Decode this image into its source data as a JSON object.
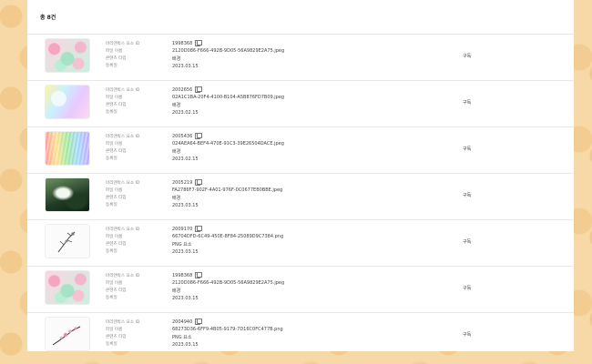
{
  "header": {
    "total": "총 8건"
  },
  "field_labels": {
    "id": "마리엔박스 요소 ID",
    "file": "파일 이름",
    "type": "콘텐츠 타입",
    "date": "등록일"
  },
  "rows": [
    {
      "id": "1998368",
      "file": "2120D086-F666-492B-9D05-56A9829E2A75.jpeg",
      "type": "배경",
      "date": "2023.03.15",
      "action": "구독",
      "thumb": "pastel-pattern"
    },
    {
      "id": "2002656",
      "file": "02A1C1BA-20F4-4100-B104-A5B876FD7B09.jpeg",
      "type": "배경",
      "date": "2023.02.15",
      "action": "구독",
      "thumb": "rainbow-texture"
    },
    {
      "id": "2005436",
      "file": "024AEA64-BEF4-470E-91C3-39E26504DACE.jpeg",
      "type": "배경",
      "date": "2023.02.15",
      "action": "구독",
      "thumb": "crayon-texture"
    },
    {
      "id": "2005219",
      "file": "FA2786F7-902F-4A01-976F-0C0677EB0BBE.jpeg",
      "type": "배경",
      "date": "2023.03.15",
      "action": "구독",
      "thumb": "green-paint"
    },
    {
      "id": "2009170",
      "file": "66704DFD-6C49-450E-8F84-25089D9C7384.png",
      "type": "PNG 요소",
      "date": "2023.03.15",
      "action": "구독",
      "thumb": "sketch-branch"
    },
    {
      "id": "1998368",
      "file": "2120D086-F666-492B-9D05-56A9829E2A75.jpeg",
      "type": "배경",
      "date": "2023.03.15",
      "action": "구독",
      "thumb": "pastel-pattern"
    },
    {
      "id": "2004940",
      "file": "68273D36-6FF9-4B05-9179-7D16C0FC477B.png",
      "type": "PNG 요소",
      "date": "2023.03.15",
      "action": "구독",
      "thumb": "pink-blossom"
    }
  ]
}
